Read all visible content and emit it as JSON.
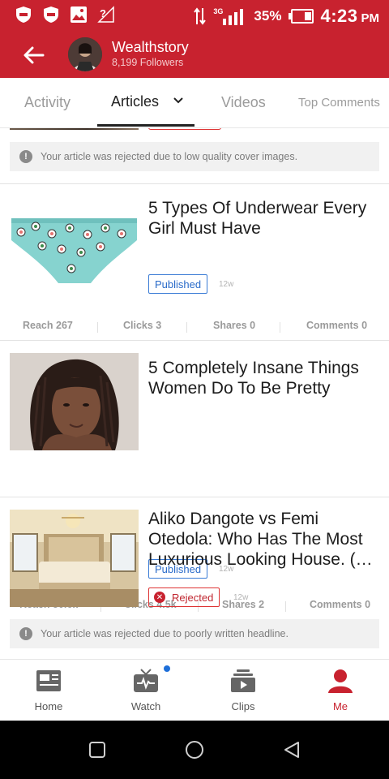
{
  "status_bar": {
    "network_label": "3G",
    "battery_percent": "35%",
    "time": "4:23",
    "time_suffix": "PM",
    "icons": [
      "shield-icon",
      "shield-icon",
      "image-icon",
      "no-signal-icon",
      "data-arrows-icon",
      "signal-icon",
      "battery-icon"
    ]
  },
  "header": {
    "channel_name": "Wealthstory",
    "followers": "8,199 Followers",
    "accent_color": "#c8222f"
  },
  "tabs": [
    {
      "label": "Activity",
      "active": false
    },
    {
      "label": "Articles",
      "active": true
    },
    {
      "label": "Videos",
      "active": false
    },
    {
      "label": "Top Comments",
      "active": false
    }
  ],
  "feed": {
    "top_notice": "Your article was rejected due to low quality cover images.",
    "articles": [
      {
        "title": "5 Types Of Underwear Every Girl Must Have",
        "status": "Published",
        "age": "12w",
        "stats": {
          "reach": "Reach 267",
          "clicks": "Clicks 3",
          "shares": "Shares 0",
          "comments": "Comments 0"
        }
      },
      {
        "title": "5 Completely Insane Things Women Do To Be Pretty",
        "status": "Published",
        "age": "12w",
        "stats": {
          "reach": "Reach 50.6k",
          "clicks": "Clicks 4.5k",
          "shares": "Shares 2",
          "comments": "Comments 0"
        }
      },
      {
        "title": "Aliko Dangote vs Femi Otedola: Who Has The Most Luxurious Looking House. (…",
        "status": "Rejected",
        "age": "12w",
        "notice": "Your article was rejected due to poorly written headline."
      }
    ]
  },
  "bottom_nav": [
    {
      "label": "Home",
      "icon": "news-icon",
      "active": false
    },
    {
      "label": "Watch",
      "icon": "tv-icon",
      "active": false
    },
    {
      "label": "Clips",
      "icon": "clips-icon",
      "active": false
    },
    {
      "label": "Me",
      "icon": "person-icon",
      "active": true
    }
  ]
}
